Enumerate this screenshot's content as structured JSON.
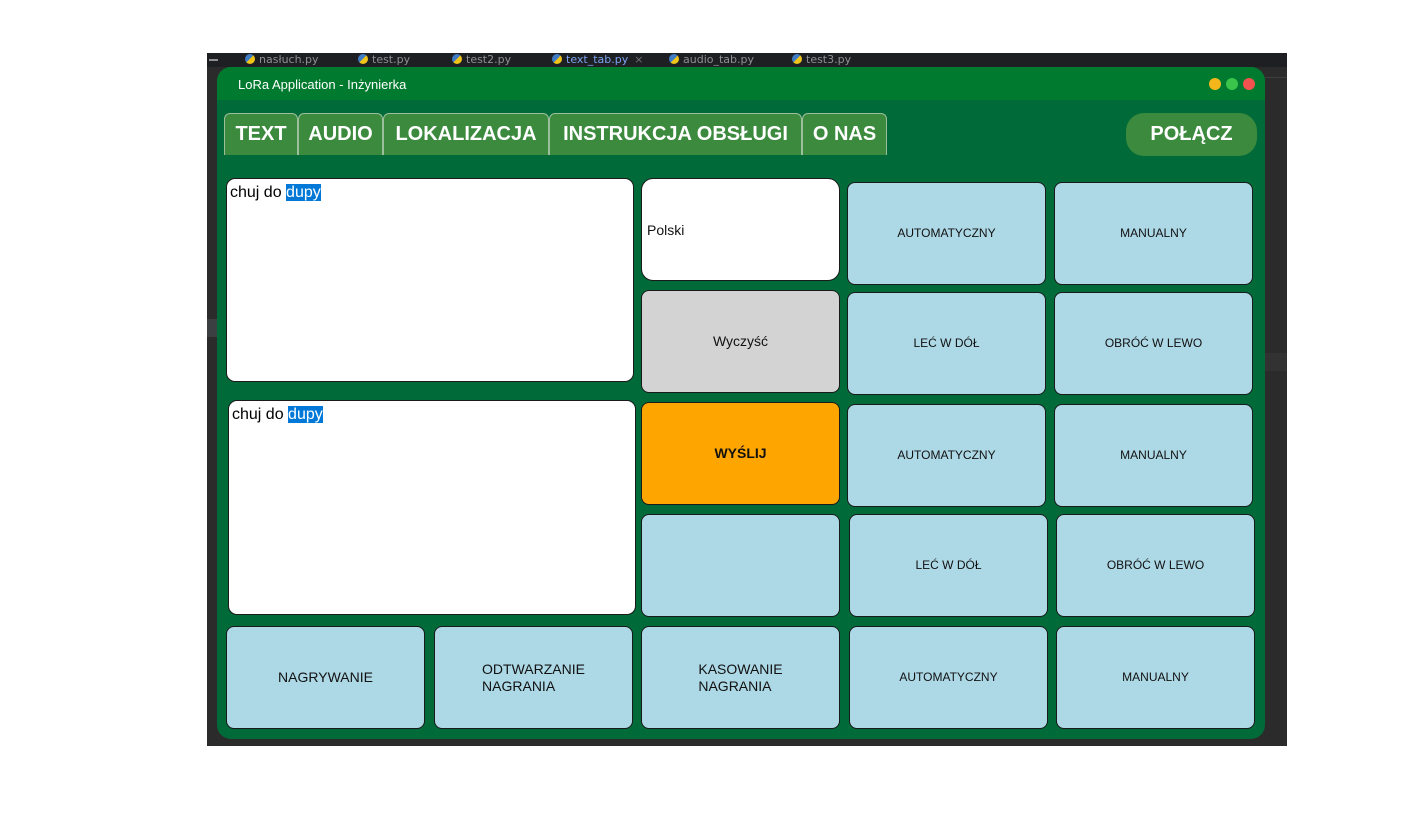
{
  "ide": {
    "tabs": [
      {
        "label": "nasłuch.py",
        "active": false
      },
      {
        "label": "test.py",
        "active": false
      },
      {
        "label": "test2.py",
        "active": false
      },
      {
        "label": "text_tab.py",
        "active": true,
        "close": "×"
      },
      {
        "label": "audio_tab.py",
        "active": false
      },
      {
        "label": "test3.py",
        "active": false
      }
    ]
  },
  "window": {
    "title": "LoRa Application - Inżynierka",
    "controls": [
      "minimize",
      "maximize",
      "close"
    ],
    "colors": {
      "background": "#006b38",
      "titlebar": "#007a2e",
      "tab": "#3b8a3e"
    }
  },
  "tabs": [
    "TEXT",
    "AUDIO",
    "LOKALIZACJA",
    "INSTRUKCJA OBSŁUGI",
    "O NAS"
  ],
  "connect_label": "POŁĄCZ",
  "input_text": {
    "plain": "chuj do ",
    "selected": "dupy"
  },
  "output_text": {
    "plain": "chuj do ",
    "selected": "dupy"
  },
  "language": "Polski",
  "clear_label": "Wyczyść",
  "send_label": "WYŚLIJ",
  "grid": {
    "row1": [
      "AUTOMATYCZNY",
      "MANUALNY"
    ],
    "row2": [
      "LEĆ W DÓŁ",
      "OBRÓĆ W LEWO"
    ],
    "row3": [
      "AUTOMATYCZNY",
      "MANUALNY"
    ],
    "row4": [
      "LEĆ W DÓŁ",
      "OBRÓĆ W LEWO"
    ],
    "row5": [
      "AUTOMATYCZNY",
      "MANUALNY"
    ]
  },
  "recording": {
    "record": "NAGRYWANIE",
    "play": [
      "ODTWARZANIE",
      "NAGRANIA"
    ],
    "delete": [
      "KASOWANIE",
      "NAGRANIA"
    ]
  },
  "colors": {
    "button": "#add8e6",
    "send": "#ffa500",
    "clear": "#d3d3d3",
    "selection": "#0078d7"
  }
}
